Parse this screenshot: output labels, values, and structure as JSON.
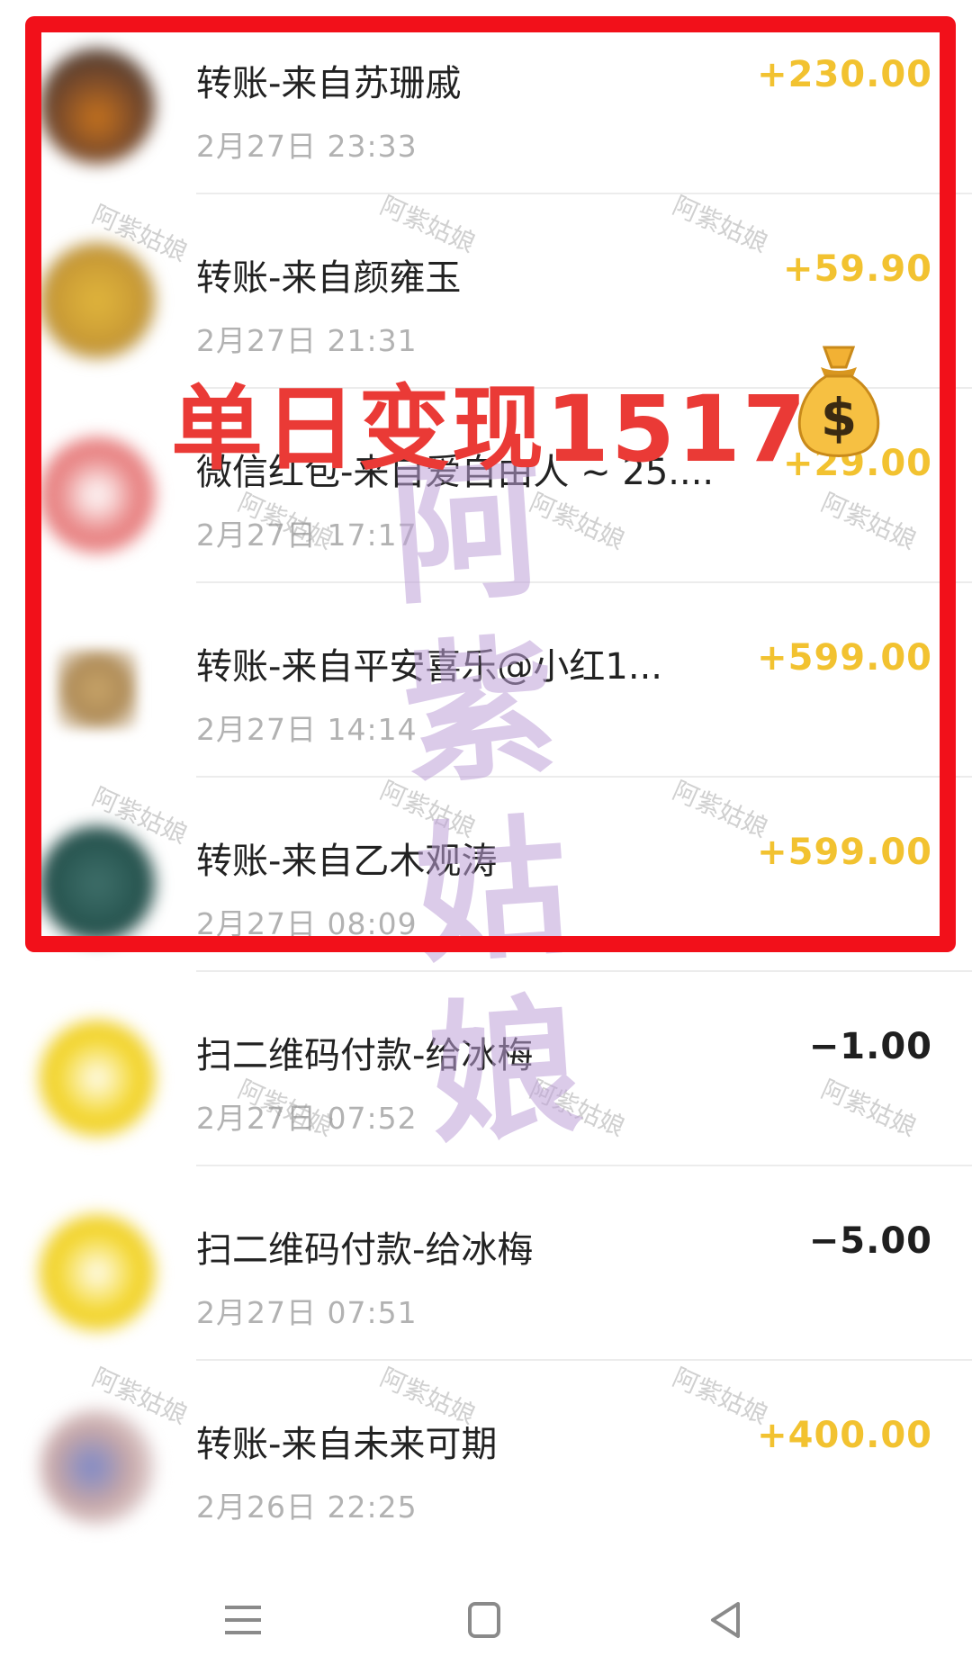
{
  "transactions": [
    {
      "title": "转账-来自苏珊戚",
      "time": "2月27日 23:33",
      "amount": "+230.00",
      "direction": "in"
    },
    {
      "title": "转账-来自颜雍玉",
      "time": "2月27日 21:31",
      "amount": "+59.90",
      "direction": "in"
    },
    {
      "title": "微信红包-来自爱自由人 ~ 25....",
      "time": "2月27日 17:17",
      "amount": "+29.00",
      "direction": "in"
    },
    {
      "title": "转账-来自平安喜乐@小红1...",
      "time": "2月27日 14:14",
      "amount": "+599.00",
      "direction": "in"
    },
    {
      "title": "转账-来自乙木观涛",
      "time": "2月27日 08:09",
      "amount": "+599.00",
      "direction": "in"
    },
    {
      "title": "扫二维码付款-给冰梅",
      "time": "2月27日 07:52",
      "amount": "−1.00",
      "direction": "out"
    },
    {
      "title": "扫二维码付款-给冰梅",
      "time": "2月27日 07:51",
      "amount": "−5.00",
      "direction": "out"
    },
    {
      "title": "转账-来自未来可期",
      "time": "2月26日 22:25",
      "amount": "+400.00",
      "direction": "in"
    }
  ],
  "overlay": {
    "headline": "单日变现1517",
    "money_bag_icon": "money-bag-icon",
    "highlight_color": "#f2101a",
    "headline_color": "#ea3a36"
  },
  "watermark": {
    "big_chars": [
      "阿",
      "紫",
      "姑",
      "娘"
    ],
    "small_text": "阿紫姑娘"
  },
  "colors": {
    "income": "#f2c230",
    "expense": "#1f1f1f",
    "time": "#b2b2b2"
  },
  "navbar": {
    "icons": [
      "menu-icon",
      "home-square-icon",
      "back-triangle-icon"
    ]
  }
}
